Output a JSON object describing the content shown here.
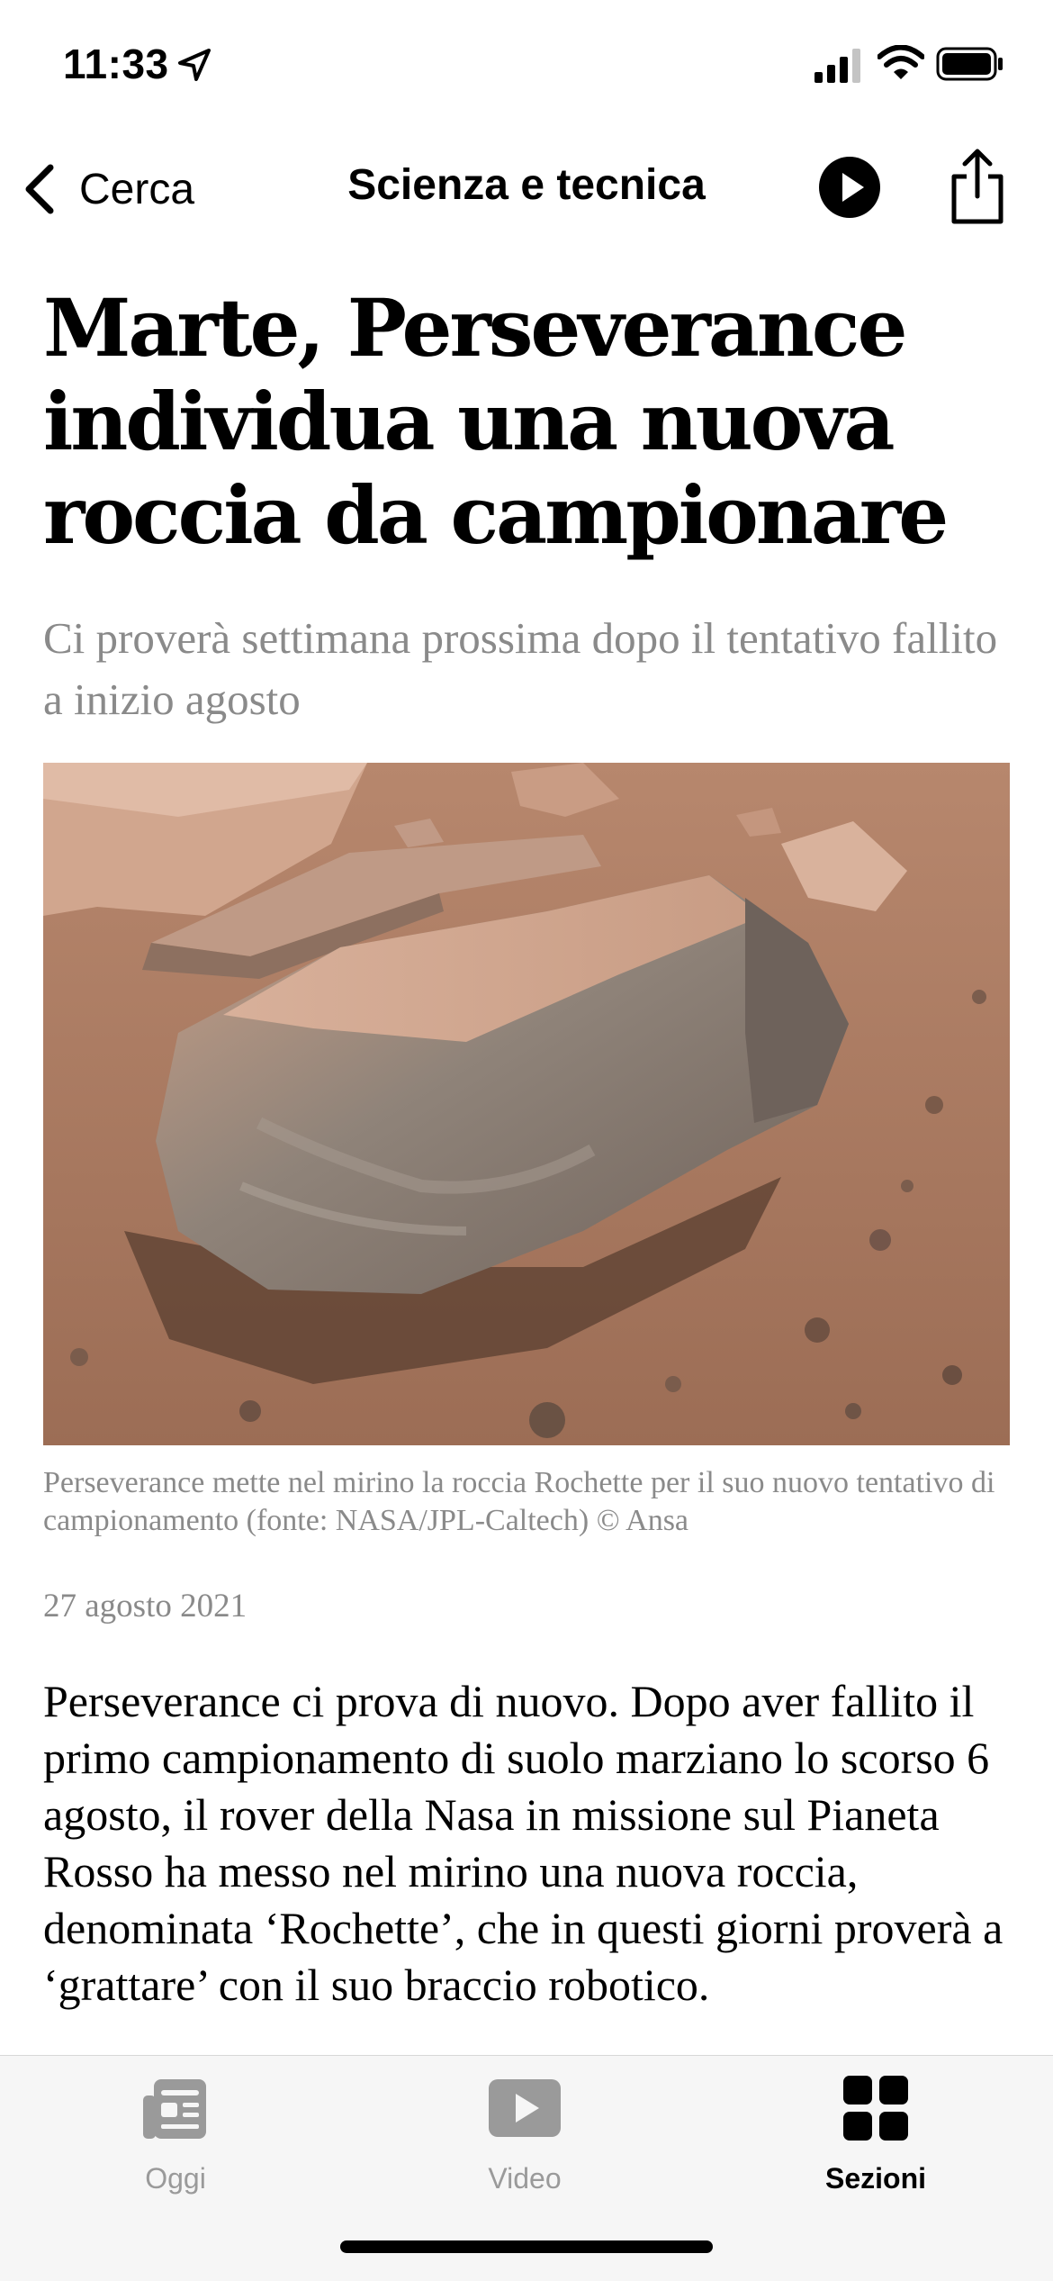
{
  "status_bar": {
    "time": "11:33"
  },
  "nav": {
    "back_label": "Cerca",
    "title": "Scienza e tecnica"
  },
  "article": {
    "headline": "Marte, Perseverance individua una nuova roccia da campionare",
    "subheadline": "Ci proverà settimana prossima dopo il tentativo fallito a inizio agosto",
    "image_caption": "Perseverance mette nel mirino la roccia Rochette per il suo nuovo tentativo di campionamento (fonte: NASA/JPL-Caltech) © Ansa",
    "date": "27 agosto 2021",
    "body": "Perseverance ci prova di nuovo. Dopo aver fallito il primo campionamento di suolo marziano lo scorso 6 agosto, il rover della Nasa in missione sul Pianeta Rosso ha messo nel mirino una nuova roccia, denominata ‘Rochette’, che in questi giorni proverà a ‘grattare’ con il suo braccio robotico."
  },
  "tab_bar": {
    "tabs": [
      {
        "label": "Oggi",
        "icon": "newspaper-icon",
        "active": false
      },
      {
        "label": "Video",
        "icon": "video-play-icon",
        "active": false
      },
      {
        "label": "Sezioni",
        "icon": "grid-sections-icon",
        "active": true
      }
    ]
  },
  "colors": {
    "secondary_text": "#8a8a8a",
    "tab_inactive": "#9a9a9a",
    "tab_active": "#000000",
    "mars_sand": "#b5826a"
  }
}
